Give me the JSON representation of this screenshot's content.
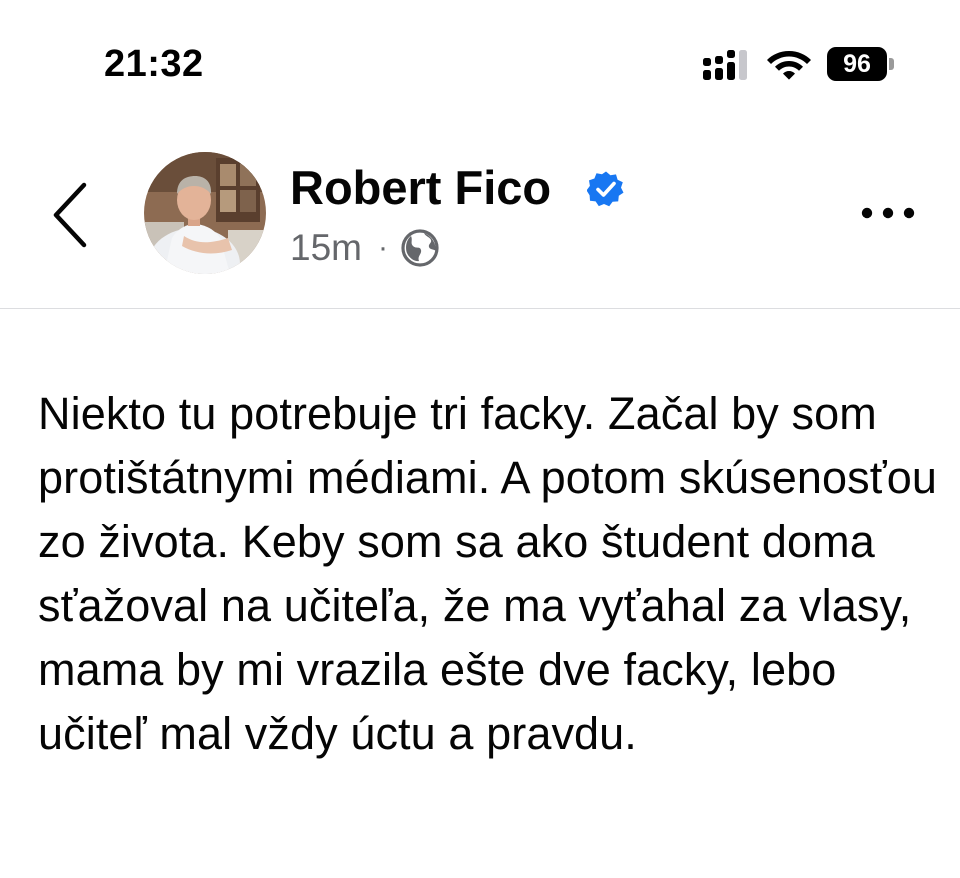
{
  "status_bar": {
    "time": "21:32",
    "battery_level": "96",
    "signal_icon": "cellular-signal-icon",
    "wifi_icon": "wifi-icon"
  },
  "post": {
    "author_name": "Robert Fico",
    "verified_icon": "verified-badge-icon",
    "time_ago": "15m",
    "separator": "·",
    "audience_icon": "globe-icon",
    "text": "Niekto tu potrebuje tri facky. Začal by som protištátnymi médiami. A potom skúsenosťou zo života. Keby som sa ako študent doma sťažoval na učiteľa, že ma vyťahal za vlasy, mama by mi vrazila ešte dve facky, lebo učiteľ mal vždy úctu a pravdu."
  },
  "navigation": {
    "back_icon": "chevron-left-icon",
    "more_icon": "more-horizontal-icon"
  },
  "colors": {
    "verified_blue": "#1877f2",
    "secondary_text": "#65676b",
    "primary_text": "#050505",
    "divider": "#dcdde0"
  }
}
